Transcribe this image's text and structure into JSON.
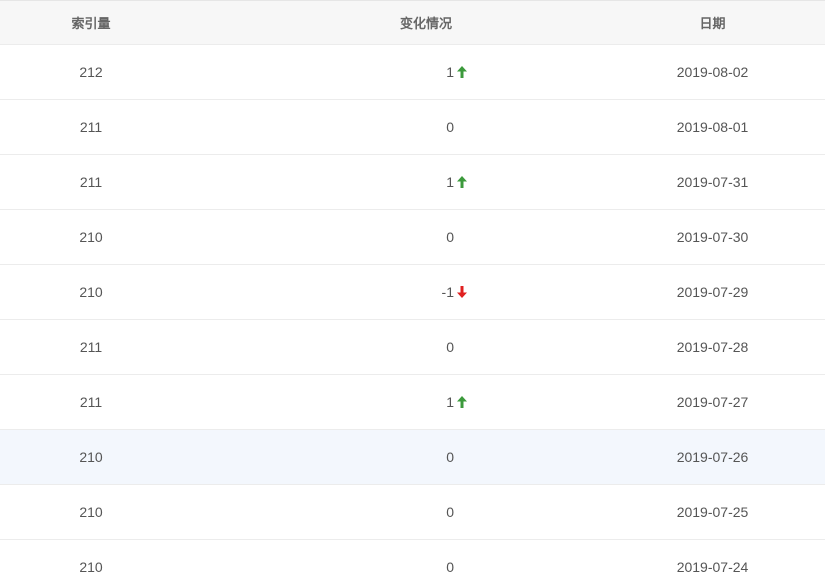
{
  "headers": {
    "col1": "索引量",
    "col2": "变化情况",
    "col3": "日期"
  },
  "colors": {
    "up": "#3c9a3c",
    "down": "#e02020",
    "highlight_row": "#f3f7fd",
    "header_bg": "#f7f7f7"
  },
  "rows": [
    {
      "index": "212",
      "change": "1",
      "trend": "up",
      "date": "2019-08-02"
    },
    {
      "index": "211",
      "change": "0",
      "trend": "none",
      "date": "2019-08-01"
    },
    {
      "index": "211",
      "change": "1",
      "trend": "up",
      "date": "2019-07-31"
    },
    {
      "index": "210",
      "change": "0",
      "trend": "none",
      "date": "2019-07-30"
    },
    {
      "index": "210",
      "change": "-1",
      "trend": "down",
      "date": "2019-07-29"
    },
    {
      "index": "211",
      "change": "0",
      "trend": "none",
      "date": "2019-07-28"
    },
    {
      "index": "211",
      "change": "1",
      "trend": "up",
      "date": "2019-07-27"
    },
    {
      "index": "210",
      "change": "0",
      "trend": "none",
      "date": "2019-07-26",
      "highlighted": true
    },
    {
      "index": "210",
      "change": "0",
      "trend": "none",
      "date": "2019-07-25"
    },
    {
      "index": "210",
      "change": "0",
      "trend": "none",
      "date": "2019-07-24"
    }
  ]
}
